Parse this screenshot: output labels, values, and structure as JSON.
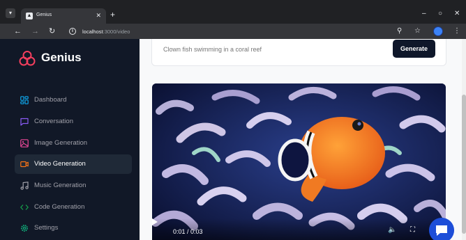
{
  "browser": {
    "tab": {
      "title": "Genius"
    },
    "url_host": "localhost",
    "url_path": ":3000/video"
  },
  "sidebar": {
    "brand": "Genius",
    "items": [
      {
        "label": "Dashboard",
        "icon": "layout-dashboard-icon",
        "color": "#0ea5e9",
        "active": false
      },
      {
        "label": "Conversation",
        "icon": "message-square-icon",
        "color": "#8b5cf6",
        "active": false
      },
      {
        "label": "Image Generation",
        "icon": "image-icon",
        "color": "#ec4899",
        "active": false
      },
      {
        "label": "Video Generation",
        "icon": "video-icon",
        "color": "#f97316",
        "active": true
      },
      {
        "label": "Music Generation",
        "icon": "music-icon",
        "color": "#10b981",
        "active": false
      },
      {
        "label": "Code Generation",
        "icon": "code-icon",
        "color": "#16a34a",
        "active": false
      },
      {
        "label": "Settings",
        "icon": "settings-icon",
        "color": "#10b981",
        "active": false
      }
    ]
  },
  "prompt": {
    "placeholder": "Clown fish swimming in a coral reef",
    "generate_label": "Generate"
  },
  "video": {
    "time": "0:01 / 0:03",
    "progress": 0.33
  },
  "colors": {
    "sidebar_bg": "#111827",
    "active_item_bg": "#1f2937",
    "button_bg": "#0f172a",
    "chat_bubble": "#1d4ed8"
  }
}
